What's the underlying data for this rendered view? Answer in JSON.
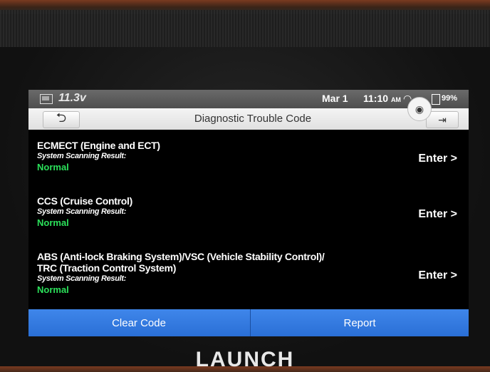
{
  "status": {
    "voltage": "11.3v",
    "date": "Mar 1",
    "time": "11:10",
    "ampm": "AM",
    "battery": "99%"
  },
  "header": {
    "title": "Diagnostic Trouble Code"
  },
  "systems": [
    {
      "name": "ECMECT (Engine and ECT)",
      "scan_label": "System Scanning Result:",
      "status": "Normal",
      "action": "Enter >"
    },
    {
      "name": "CCS (Cruise Control)",
      "scan_label": "System Scanning Result:",
      "status": "Normal",
      "action": "Enter >"
    },
    {
      "name_line1": "ABS (Anti-lock Braking System)/VSC (Vehicle Stability Control)/",
      "name_line2": "TRC (Traction Control System)",
      "scan_label": "System Scanning Result:",
      "status": "Normal",
      "action": "Enter >"
    }
  ],
  "footer": {
    "clear_label": "Clear Code",
    "report_label": "Report"
  },
  "brand": "LAUNCH",
  "colors": {
    "accent": "#2a6fd6",
    "ok": "#2be05a"
  }
}
